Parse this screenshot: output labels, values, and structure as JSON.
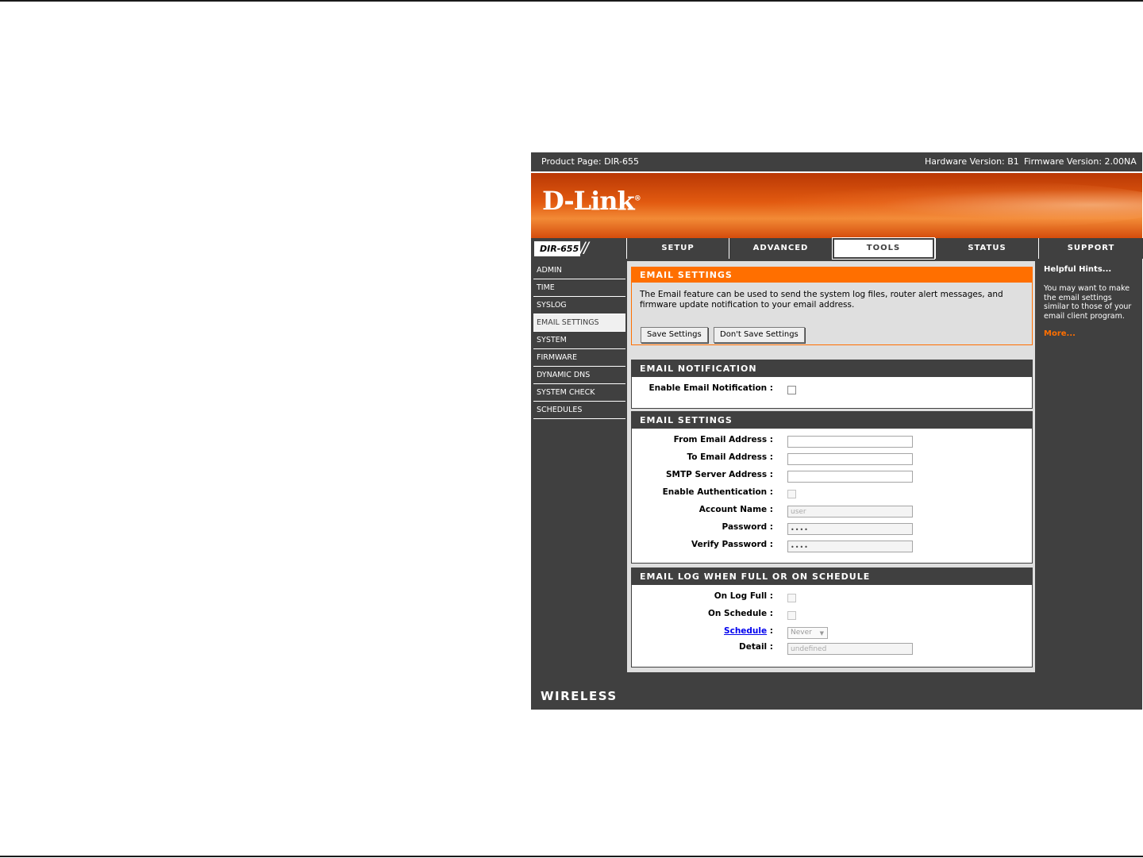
{
  "header": {
    "product_page": "Product Page: DIR-655",
    "hardware_version": "Hardware Version: B1",
    "firmware_version": "Firmware Version: 2.00NA"
  },
  "brand": {
    "logo": "D-Link",
    "model": "DIR-655",
    "footer": "WIRELESS"
  },
  "nav": {
    "tabs": [
      "SETUP",
      "ADVANCED",
      "TOOLS",
      "STATUS",
      "SUPPORT"
    ],
    "active": "TOOLS"
  },
  "sidebar": {
    "items": [
      "ADMIN",
      "TIME",
      "SYSLOG",
      "EMAIL SETTINGS",
      "SYSTEM",
      "FIRMWARE",
      "DYNAMIC DNS",
      "SYSTEM CHECK",
      "SCHEDULES"
    ],
    "active": "EMAIL SETTINGS"
  },
  "intro": {
    "title": "EMAIL SETTINGS",
    "text": "The Email feature can be used to send the system log files, router alert messages, and firmware update notification to your email address.",
    "save_label": "Save Settings",
    "dont_save_label": "Don't Save Settings"
  },
  "notification": {
    "title": "EMAIL NOTIFICATION",
    "enable_label": "Enable Email Notification :",
    "enabled": false
  },
  "settings": {
    "title": "EMAIL SETTINGS",
    "from_label": "From Email Address :",
    "from_value": "",
    "to_label": "To Email Address :",
    "to_value": "",
    "smtp_label": "SMTP Server Address :",
    "smtp_value": "",
    "auth_label": "Enable Authentication :",
    "auth_enabled": false,
    "account_label": "Account Name :",
    "account_value": "user",
    "password_label": "Password :",
    "password_value": "••••",
    "verify_label": "Verify Password :",
    "verify_value": "••••"
  },
  "log": {
    "title": "EMAIL LOG WHEN FULL OR ON SCHEDULE",
    "log_full_label": "On Log Full :",
    "on_schedule_label": "On Schedule :",
    "schedule_link": "Schedule",
    "schedule_colon": " :",
    "schedule_value": "Never",
    "detail_label": "Detail :",
    "detail_value": "undefined"
  },
  "hints": {
    "title": "Helpful Hints...",
    "text": "You may want to make the email settings similar to those of your email client program.",
    "more": "More..."
  },
  "colors": {
    "accent": "#ff6f00",
    "dark": "#404040",
    "panel": "#dfdfdf"
  }
}
